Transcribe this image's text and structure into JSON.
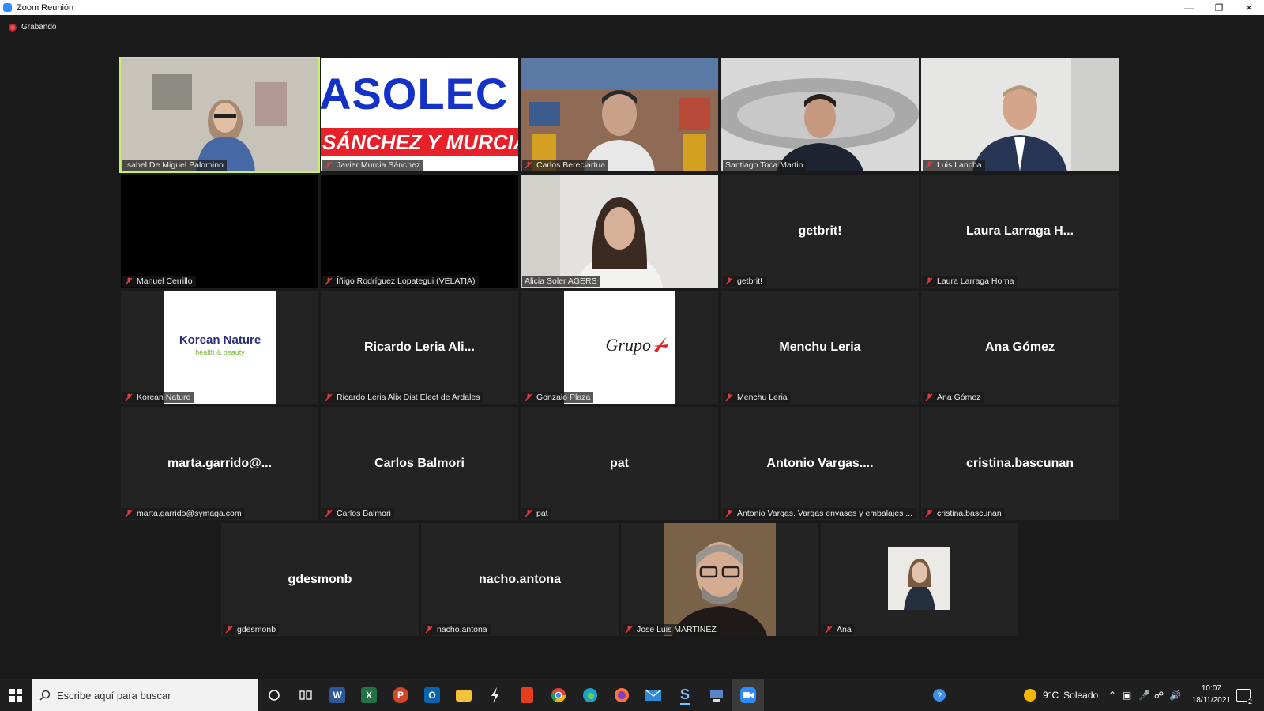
{
  "window": {
    "title": "Zoom Reunión",
    "minimize_icon": "minimize-icon",
    "restore_icon": "restore-icon",
    "close_icon": "close-icon"
  },
  "recording": {
    "label": "Grabando"
  },
  "participants": [
    {
      "name": "Isabel De Miguel Palomino",
      "display": "",
      "kind": "video",
      "active": true
    },
    {
      "name": "Javier Murcia Sánchez",
      "display": "",
      "kind": "banner",
      "banner_top": "ASOLEC",
      "banner_bottom": "SÁNCHEZ Y MURCIA"
    },
    {
      "name": "Carlos Bereciartua",
      "display": "",
      "kind": "video"
    },
    {
      "name": "Santiago Toca Martin",
      "display": "",
      "kind": "video"
    },
    {
      "name": "Luis Lancha",
      "display": "",
      "kind": "video"
    },
    {
      "name": "Manuel Cerrillo",
      "display": "",
      "kind": "black"
    },
    {
      "name": "Íñigo Rodríguez Lopategui (VELATIA)",
      "display": "",
      "kind": "black"
    },
    {
      "name": "Alicia Soler  AGERS",
      "display": "",
      "kind": "video"
    },
    {
      "name": "getbrit!",
      "display": "getbrit!",
      "kind": "name"
    },
    {
      "name": "Laura Larraga Horna",
      "display": "Laura Larraga H...",
      "kind": "name"
    },
    {
      "name": "Korean Nature",
      "display": "",
      "kind": "logo",
      "logo_main": "Korean Nature",
      "logo_sub": "health & beauty"
    },
    {
      "name": "Ricardo Leria Alix Dist Elect de Ardales",
      "display": "Ricardo Leria Ali...",
      "kind": "name"
    },
    {
      "name": "Gonzalo Plaza",
      "display": "",
      "kind": "logo",
      "logo_main": "Grupo"
    },
    {
      "name": "Menchu Leria",
      "display": "Menchu Leria",
      "kind": "name"
    },
    {
      "name": "Ana Gómez",
      "display": "Ana Gómez",
      "kind": "name"
    },
    {
      "name": "marta.garrido@symaga.com",
      "display": "marta.garrido@...",
      "kind": "name"
    },
    {
      "name": "Carlos Balmori",
      "display": "Carlos Balmori",
      "kind": "name"
    },
    {
      "name": "pat",
      "display": "pat",
      "kind": "name"
    },
    {
      "name": "Antonio Vargas. Vargas envases y embalajes ...",
      "display": "Antonio Vargas....",
      "kind": "name"
    },
    {
      "name": "cristina.bascunan",
      "display": "cristina.bascunan",
      "kind": "name"
    },
    {
      "name": "gdesmonb",
      "display": "gdesmonb",
      "kind": "name"
    },
    {
      "name": "nacho.antona",
      "display": "nacho.antona",
      "kind": "name"
    },
    {
      "name": "Jose Luis MARTINEZ",
      "display": "",
      "kind": "photo"
    },
    {
      "name": "Ana",
      "display": "",
      "kind": "photo"
    }
  ],
  "taskbar": {
    "search_placeholder": "Escribe aquí para buscar",
    "apps": [
      "cortana-icon",
      "task-view-icon",
      "word-icon",
      "excel-icon",
      "powerpoint-icon",
      "outlook-icon",
      "file-explorer-icon",
      "lightning-app-icon",
      "office-icon",
      "chrome-icon",
      "edge-icon",
      "firefox-icon",
      "mail-icon",
      "s-app-icon",
      "network-app-icon",
      "zoom-icon"
    ],
    "weather": {
      "temp": "9°C",
      "condition": "Soleado"
    },
    "time": "10:07",
    "date": "18/11/2021",
    "notifications": "2"
  }
}
